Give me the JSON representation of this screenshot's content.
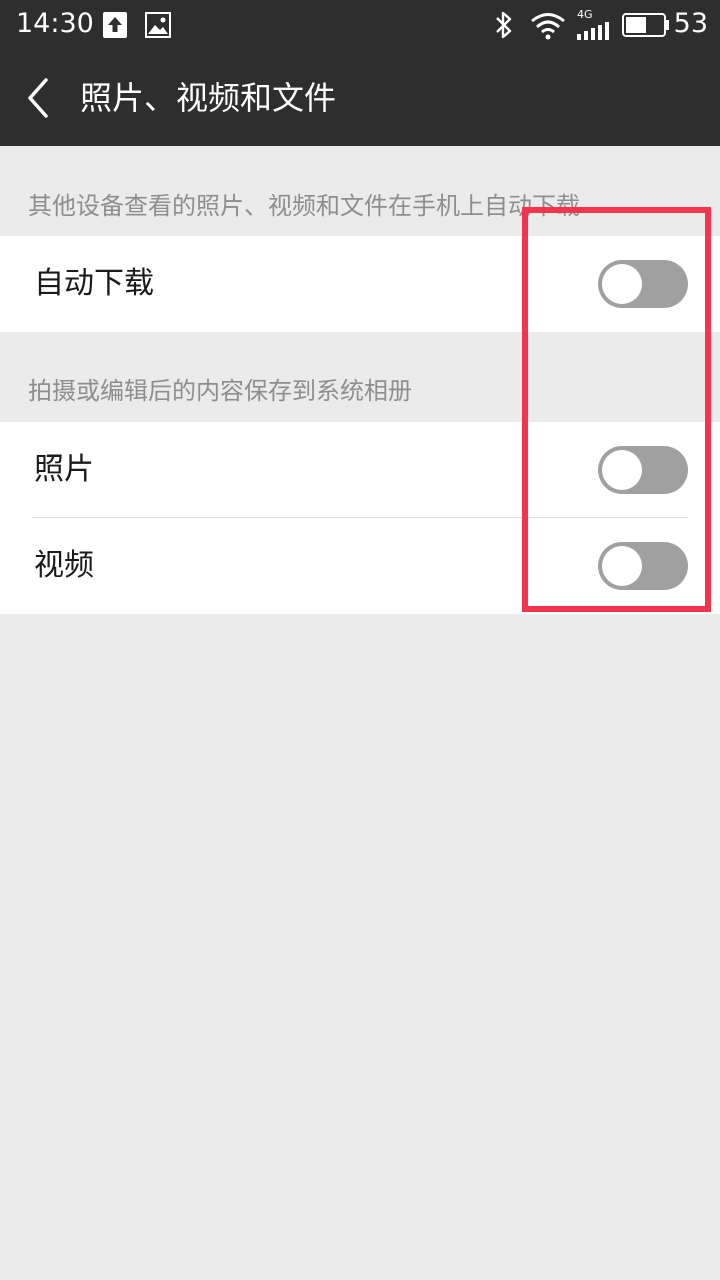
{
  "status_bar": {
    "time": "14:30",
    "battery": "53",
    "network": "4G",
    "icons": [
      "upload-icon",
      "image-icon",
      "bluetooth-icon",
      "wifi-icon",
      "signal-icon",
      "battery-icon"
    ]
  },
  "app_bar": {
    "title": "照片、视频和文件",
    "back_icon": "chevron-left-icon"
  },
  "sections": {
    "auto_download": {
      "header": "其他设备查看的照片、视频和文件在手机上自动下载",
      "rows": [
        {
          "label": "自动下载",
          "enabled": false
        }
      ]
    },
    "save_to_album": {
      "header": "拍摄或编辑后的内容保存到系统相册",
      "rows": [
        {
          "label": "照片",
          "enabled": false
        },
        {
          "label": "视频",
          "enabled": false
        }
      ]
    }
  },
  "colors": {
    "bar_bg": "#2e2e2e",
    "page_bg": "#ebebeb",
    "switch_off": "#a0a0a0",
    "highlight": "#f0354c"
  }
}
